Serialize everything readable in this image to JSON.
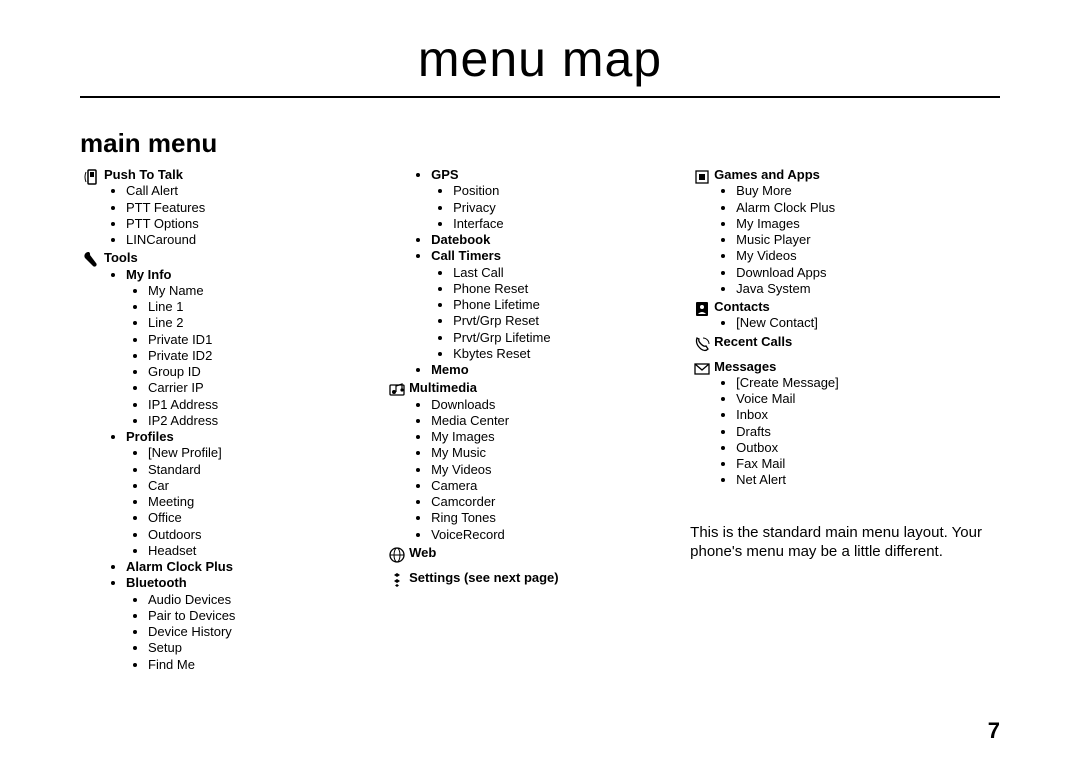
{
  "page_title": "menu map",
  "section_heading": "main menu",
  "note_line1": "This is the standard main menu layout. Your",
  "note_line2": "phone's menu may be a little different.",
  "page_number": "7",
  "col1": {
    "push_to_talk": {
      "label": "Push To Talk",
      "items": [
        "Call Alert",
        "PTT Features",
        "PTT Options",
        "LINCaround"
      ]
    },
    "tools": {
      "label": "Tools",
      "my_info": {
        "label": "My Info",
        "items": [
          "My Name",
          "Line 1",
          "Line 2",
          "Private ID1",
          "Private ID2",
          "Group ID",
          "Carrier IP",
          "IP1 Address",
          "IP2 Address"
        ]
      },
      "profiles": {
        "label": "Profiles",
        "items": [
          "[New Profile]",
          "Standard",
          "Car",
          "Meeting",
          "Office",
          "Outdoors",
          "Headset"
        ]
      },
      "alarm_clock_plus": {
        "label": "Alarm Clock Plus"
      },
      "bluetooth": {
        "label": "Bluetooth",
        "items": [
          "Audio Devices",
          "Pair to Devices",
          "Device History",
          "Setup",
          "Find Me"
        ]
      }
    }
  },
  "col2": {
    "tools_cont": {
      "gps": {
        "label": "GPS",
        "items": [
          "Position",
          "Privacy",
          "Interface"
        ]
      },
      "datebook": {
        "label": "Datebook"
      },
      "call_timers": {
        "label": "Call Timers",
        "items": [
          "Last Call",
          "Phone Reset",
          "Phone Lifetime",
          "Prvt/Grp Reset",
          "Prvt/Grp Lifetime",
          "Kbytes Reset"
        ]
      },
      "memo": {
        "label": "Memo"
      }
    },
    "multimedia": {
      "label": "Multimedia",
      "items": [
        "Downloads",
        "Media Center",
        "My Images",
        "My Music",
        "My Videos",
        "Camera",
        "Camcorder",
        "Ring Tones",
        "VoiceRecord"
      ]
    },
    "web": {
      "label": "Web"
    },
    "settings": {
      "label": "Settings (see next page)"
    }
  },
  "col3": {
    "games_apps": {
      "label": "Games and Apps",
      "items": [
        "Buy More",
        "Alarm Clock Plus",
        "My Images",
        "Music Player",
        "My Videos",
        "Download Apps",
        "Java System"
      ]
    },
    "contacts": {
      "label": "Contacts",
      "items": [
        "[New Contact]"
      ]
    },
    "recent_calls": {
      "label": "Recent Calls"
    },
    "messages": {
      "label": "Messages",
      "items": [
        "[Create Message]",
        "Voice Mail",
        "Inbox",
        "Drafts",
        "Outbox",
        "Fax Mail",
        "Net Alert"
      ]
    }
  }
}
